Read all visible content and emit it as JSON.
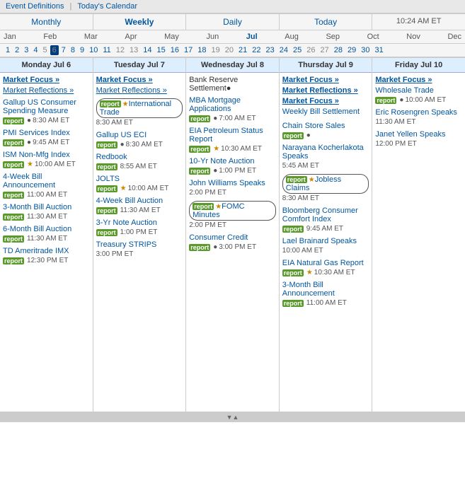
{
  "topNav": {
    "eventDefs": "Event Definitions",
    "separator": "|",
    "todaysCal": "Today's Calendar"
  },
  "periods": [
    {
      "label": "Monthly",
      "active": false
    },
    {
      "label": "Weekly",
      "active": true
    },
    {
      "label": "Daily",
      "active": false
    },
    {
      "label": "Today",
      "active": false
    },
    {
      "label": "10:24 AM ET",
      "active": false,
      "isTime": true
    }
  ],
  "months": [
    "Jan",
    "Feb",
    "Mar",
    "Apr",
    "May",
    "Jun",
    "Jul",
    "Aug",
    "Sep",
    "Oct",
    "Nov",
    "Dec"
  ],
  "activeMonth": "Jul",
  "dayRows": [
    [
      "1",
      "2",
      "3",
      "4",
      "5",
      "6",
      "7",
      "8",
      "9",
      "10",
      "11",
      "12",
      "13",
      "14",
      "15",
      "16",
      "17",
      "18",
      "19",
      "20",
      "21",
      "22",
      "23",
      "24",
      "25",
      "26",
      "27",
      "28",
      "29",
      "30",
      "31"
    ]
  ],
  "activeDay": "6",
  "columns": [
    {
      "header": "Monday Jul 6",
      "isToday": false,
      "events": [
        {
          "type": "focus",
          "text": "Market Focus »"
        },
        {
          "type": "reflections",
          "text": "Market Reflections »"
        },
        {
          "type": "spacer"
        },
        {
          "type": "item",
          "name": "Gallup US Consumer Spending Measure",
          "badge": "report",
          "star": false,
          "bullet": true,
          "time": "8:30 AM ET",
          "circled": false
        },
        {
          "type": "spacer"
        },
        {
          "type": "item",
          "name": "PMI Services Index",
          "badge": "report",
          "star": false,
          "bullet": true,
          "time": "9:45 AM ET",
          "circled": false
        },
        {
          "type": "spacer"
        },
        {
          "type": "item",
          "name": "ISM Non-Mfg Index",
          "badge": "report",
          "star": true,
          "bullet": false,
          "time": "10:00 AM ET",
          "circled": false
        },
        {
          "type": "spacer"
        },
        {
          "type": "item",
          "name": "4-Week Bill Announcement",
          "badge": "report",
          "star": false,
          "bullet": false,
          "time": "11:00 AM ET",
          "circled": false
        },
        {
          "type": "spacer"
        },
        {
          "type": "item",
          "name": "3-Month Bill Auction",
          "badge": "report",
          "star": false,
          "bullet": false,
          "time": "11:30 AM ET",
          "circled": false
        },
        {
          "type": "spacer"
        },
        {
          "type": "item",
          "name": "6-Month Bill Auction",
          "badge": "report",
          "star": false,
          "bullet": false,
          "time": "11:30 AM ET",
          "circled": false
        },
        {
          "type": "spacer"
        },
        {
          "type": "item",
          "name": "TD Ameritrade IMX",
          "badge": "report",
          "star": false,
          "bullet": false,
          "time": "12:30 PM ET",
          "circled": false
        }
      ]
    },
    {
      "header": "Tuesday Jul 7",
      "isToday": false,
      "events": [
        {
          "type": "focus",
          "text": "Market Focus »"
        },
        {
          "type": "reflections",
          "text": "Market Reflections »"
        },
        {
          "type": "spacer"
        },
        {
          "type": "item",
          "name": "International Trade",
          "badge": "report",
          "star": true,
          "bullet": false,
          "time": "8:30 AM ET",
          "circled": true
        },
        {
          "type": "spacer"
        },
        {
          "type": "item",
          "name": "Gallup US ECI",
          "badge": "report",
          "star": false,
          "bullet": true,
          "time": "8:30 AM ET",
          "circled": false
        },
        {
          "type": "spacer"
        },
        {
          "type": "item",
          "name": "Redbook",
          "badge": "report",
          "star": false,
          "bullet": false,
          "time": "8:55 AM ET",
          "circled": false
        },
        {
          "type": "spacer"
        },
        {
          "type": "item",
          "name": "JOLTS",
          "badge": "report",
          "star": true,
          "bullet": false,
          "time": "10:00 AM ET",
          "circled": false
        },
        {
          "type": "spacer"
        },
        {
          "type": "item",
          "name": "4-Week Bill Auction",
          "badge": "report",
          "star": false,
          "bullet": false,
          "time": "11:30 AM ET",
          "circled": false
        },
        {
          "type": "spacer"
        },
        {
          "type": "item",
          "name": "3-Yr Note Auction",
          "badge": "report",
          "star": false,
          "bullet": false,
          "time": "1:00 PM ET",
          "circled": false
        },
        {
          "type": "spacer"
        },
        {
          "type": "item",
          "name": "Treasury STRIPS",
          "badge": null,
          "star": false,
          "bullet": false,
          "time": "3:00 PM ET",
          "circled": false
        }
      ]
    },
    {
      "header": "Wednesday Jul 8",
      "isToday": false,
      "events": [
        {
          "type": "plain",
          "text": "Bank Reserve Settlement●"
        },
        {
          "type": "spacer"
        },
        {
          "type": "item",
          "name": "MBA Mortgage Applications",
          "badge": "report",
          "star": false,
          "bullet": true,
          "time": "7:00 AM ET",
          "circled": false
        },
        {
          "type": "spacer"
        },
        {
          "type": "item",
          "name": "EIA Petroleum Status Report",
          "badge": "report",
          "star": true,
          "bullet": false,
          "time": "10:30 AM ET",
          "circled": false
        },
        {
          "type": "spacer"
        },
        {
          "type": "item",
          "name": "10-Yr Note Auction",
          "badge": "report",
          "star": false,
          "bullet": true,
          "time": "1:00 PM ET",
          "circled": false
        },
        {
          "type": "spacer"
        },
        {
          "type": "item",
          "name": "John Williams Speaks",
          "badge": null,
          "star": false,
          "bullet": false,
          "time": "2:00 PM ET",
          "circled": false
        },
        {
          "type": "spacer"
        },
        {
          "type": "item",
          "name": "FOMC Minutes",
          "badge": "report",
          "star": true,
          "bullet": false,
          "time": "2:00 PM ET",
          "circled": true
        },
        {
          "type": "spacer"
        },
        {
          "type": "item",
          "name": "Consumer Credit",
          "badge": "report",
          "star": false,
          "bullet": true,
          "time": "3:00 PM ET",
          "circled": false
        }
      ]
    },
    {
      "header": "Thursday Jul 9",
      "isToday": false,
      "events": [
        {
          "type": "focus",
          "text": "Market Focus »"
        },
        {
          "type": "spacer"
        },
        {
          "type": "focus2",
          "text": "Market Reflections »"
        },
        {
          "type": "spacer"
        },
        {
          "type": "focus2",
          "text": "Market Focus »"
        },
        {
          "type": "spacer"
        },
        {
          "type": "item",
          "name": "Weekly Bill Settlement",
          "badge": null,
          "star": false,
          "bullet": false,
          "time": "",
          "circled": false
        },
        {
          "type": "spacer"
        },
        {
          "type": "item",
          "name": "Chain Store Sales",
          "badge": "report",
          "star": false,
          "bullet": true,
          "time": "",
          "circled": false
        },
        {
          "type": "spacer"
        },
        {
          "type": "item",
          "name": "Narayana Kocherlakota Speaks",
          "badge": null,
          "star": false,
          "bullet": false,
          "time": "5:45 AM ET",
          "circled": false
        },
        {
          "type": "spacer"
        },
        {
          "type": "item",
          "name": "Jobless Claims",
          "badge": "report",
          "star": true,
          "bullet": false,
          "time": "8:30 AM ET",
          "circled": true
        },
        {
          "type": "spacer"
        },
        {
          "type": "item",
          "name": "Bloomberg Consumer Comfort Index",
          "badge": "report",
          "star": false,
          "bullet": false,
          "time": "9:45 AM ET",
          "circled": false
        },
        {
          "type": "spacer"
        },
        {
          "type": "item",
          "name": "Lael Brainard Speaks",
          "badge": null,
          "star": false,
          "bullet": false,
          "time": "10:00 AM ET",
          "circled": false
        },
        {
          "type": "spacer"
        },
        {
          "type": "item",
          "name": "EIA Natural Gas Report",
          "badge": "report",
          "star": true,
          "bullet": false,
          "time": "10:30 AM ET",
          "circled": false
        },
        {
          "type": "spacer"
        },
        {
          "type": "item",
          "name": "3-Month Bill Announcement",
          "badge": "report",
          "star": false,
          "bullet": false,
          "time": "11:00 AM ET",
          "circled": false
        }
      ]
    },
    {
      "header": "Friday Jul 10",
      "isToday": false,
      "events": [
        {
          "type": "focus",
          "text": "Market Focus »"
        },
        {
          "type": "spacer"
        },
        {
          "type": "item",
          "name": "Wholesale Trade",
          "badge": "report",
          "star": false,
          "bullet": true,
          "time": "10:00 AM ET",
          "circled": false
        },
        {
          "type": "spacer"
        },
        {
          "type": "item",
          "name": "Eric Rosengren Speaks",
          "badge": null,
          "star": false,
          "bullet": false,
          "time": "11:30 AM ET",
          "circled": false
        },
        {
          "type": "spacer"
        },
        {
          "type": "item",
          "name": "Janet Yellen Speaks",
          "badge": null,
          "star": false,
          "bullet": false,
          "time": "12:00 PM ET",
          "circled": false
        }
      ]
    }
  ]
}
